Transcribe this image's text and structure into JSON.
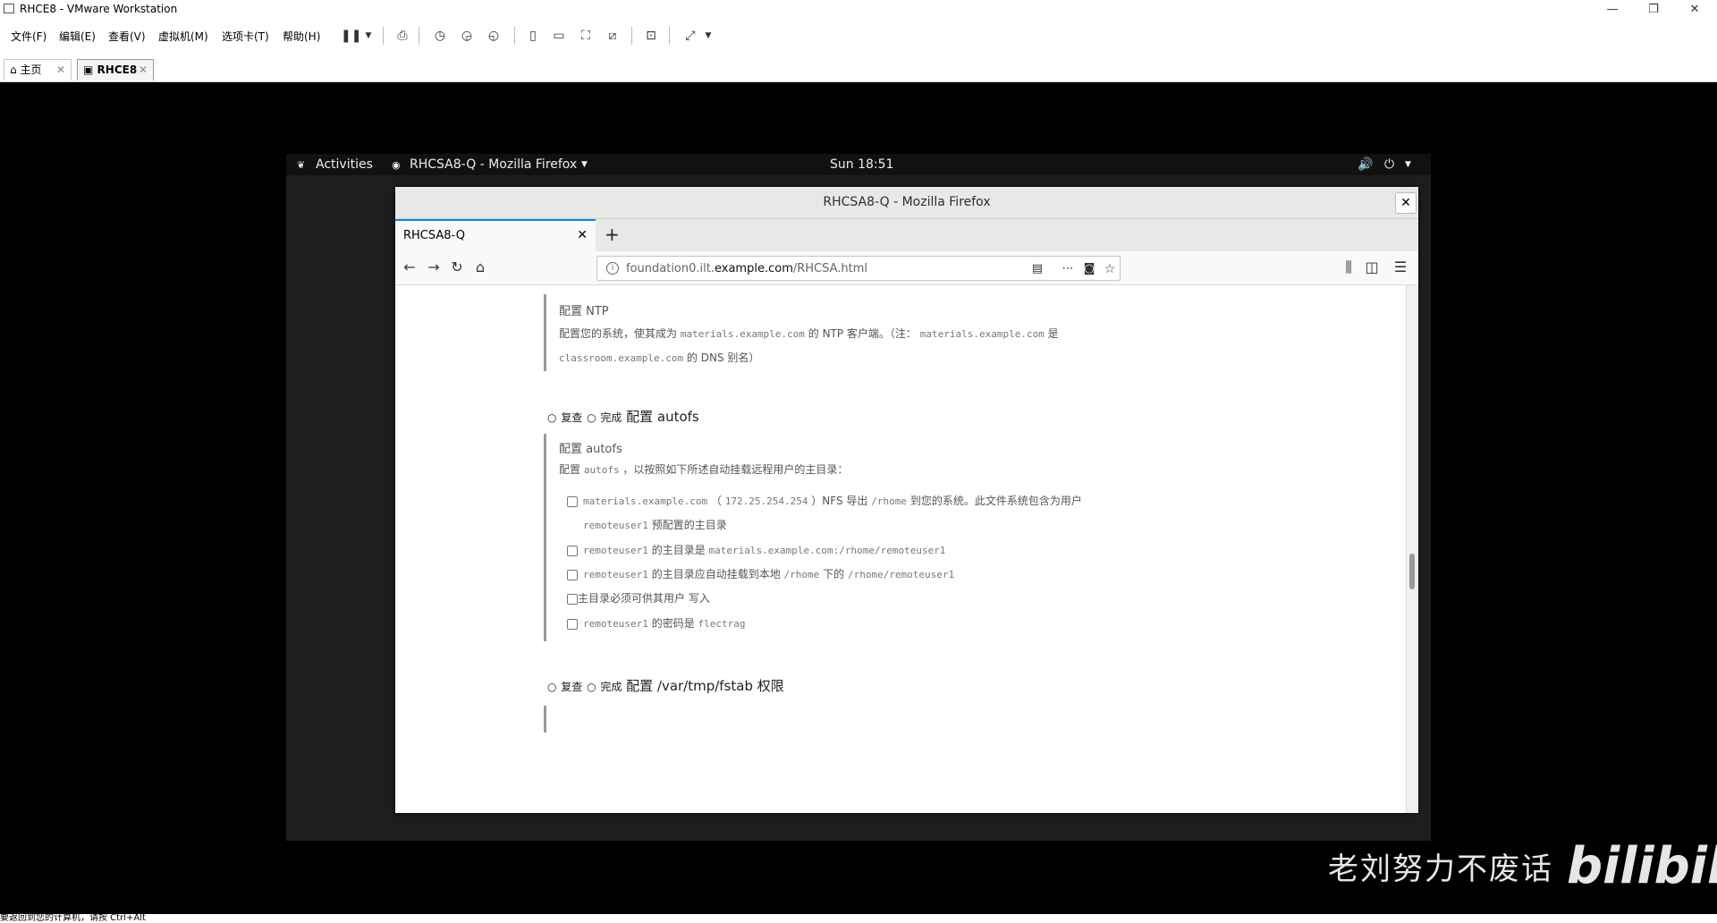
{
  "vmware": {
    "window_title": "RHCE8 - VMware Workstation",
    "menus": [
      "文件(F)",
      "编辑(E)",
      "查看(V)",
      "虚拟机(M)",
      "选项卡(T)",
      "帮助(H)"
    ],
    "tabs": [
      {
        "label": "主页"
      },
      {
        "label": "RHCE8"
      }
    ],
    "status_text": "要返回到您的计算机，请按 Ctrl+Alt"
  },
  "gnome": {
    "activities": "Activities",
    "app_menu": "RHCSA8-Q - Mozilla Firefox",
    "clock": "Sun 18:51"
  },
  "firefox": {
    "window_title": "RHCSA8-Q - Mozilla Firefox",
    "tab_title": "RHCSA8-Q",
    "url_prefix": "foundation0.ilt.",
    "url_domain": "example.com",
    "url_path": "/RHCSA.html"
  },
  "page": {
    "ntp": {
      "title": "配置 NTP",
      "line1_a": "配置您的系统，使其成为",
      "line1_code1": "materials.example.com",
      "line1_b": "的 NTP 客户端。（注：",
      "line1_code2": "materials.example.com",
      "line1_c": "是",
      "line2_code": "classroom.example.com",
      "line2_b": "的 DNS 别名）"
    },
    "autofs_heading": {
      "review": "复查",
      "done": "完成",
      "title": "配置 autofs"
    },
    "autofs": {
      "title": "配置 autofs",
      "intro_a": "配置",
      "intro_code": "autofs",
      "intro_b": "，以按照如下所述自动挂载远程用户的主目录：",
      "task1_code1": "materials.example.com",
      "task1_a": "（",
      "task1_code2": "172.25.254.254",
      "task1_b": "）NFS 导出",
      "task1_code3": "/rhome",
      "task1_c": "到您的系统。此文件系统包含为用户",
      "task1_code4": "remoteuser1",
      "task1_d": "预配置的主目录",
      "task2_code1": "remoteuser1",
      "task2_a": "的主目录是",
      "task2_code2": "materials.example.com:/rhome/remoteuser1",
      "task3_code1": "remoteuser1",
      "task3_a": "的主目录应自动挂载到本地",
      "task3_code2": "/rhome",
      "task3_b": "下的",
      "task3_code3": "/rhome/remoteuser1",
      "task4_a": "主目录必须可供其用户",
      "task4_b": "写入",
      "task5_code1": "remoteuser1",
      "task5_a": "的密码是",
      "task5_code2": "flectrag"
    },
    "fstab_heading": {
      "review": "复查",
      "done": "完成",
      "title": "配置 /var/tmp/fstab 权限"
    }
  },
  "watermark": {
    "text": "老刘努力不废话",
    "logo": "bilibili"
  }
}
